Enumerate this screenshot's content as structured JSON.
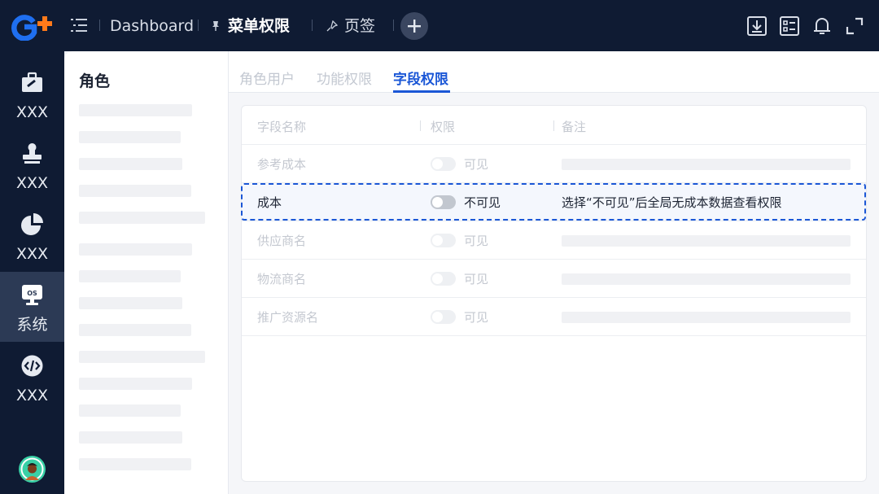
{
  "header": {
    "breadcrumbs": [
      {
        "label": "Dashboard"
      },
      {
        "label": "菜单权限",
        "active": true
      },
      {
        "label": "页签"
      }
    ],
    "tools": [
      "download-icon",
      "checklist-icon",
      "bell-icon",
      "fullscreen-icon"
    ]
  },
  "rail": {
    "items": [
      {
        "label": "XXX",
        "icon": "toolbox-icon"
      },
      {
        "label": "XXX",
        "icon": "stamp-icon"
      },
      {
        "label": "XXX",
        "icon": "pie-chart-icon"
      },
      {
        "label": "系统",
        "icon": "os-monitor-icon",
        "badge": "OS",
        "active": true
      },
      {
        "label": "XXX",
        "icon": "code-icon"
      }
    ]
  },
  "roles_panel": {
    "title": "角色"
  },
  "tabs": [
    {
      "label": "角色用户"
    },
    {
      "label": "功能权限"
    },
    {
      "label": "字段权限",
      "active": true
    }
  ],
  "table": {
    "columns": [
      "字段名称",
      "权限",
      "备注"
    ],
    "rows": [
      {
        "name": "参考成本",
        "permission": "可见",
        "enabled": true
      },
      {
        "name": "成本",
        "permission": "不可见",
        "enabled": false,
        "note": "选择“不可见”后全局无成本数据查看权限",
        "highlighted": true
      },
      {
        "name": "供应商名",
        "permission": "可见",
        "enabled": true
      },
      {
        "name": "物流商名",
        "permission": "可见",
        "enabled": true
      },
      {
        "name": "推广资源名",
        "permission": "可见",
        "enabled": true
      }
    ]
  },
  "colors": {
    "nav_bg": "#0f1b33",
    "accent": "#1b57d6",
    "logo_blue": "#1f6ff0",
    "logo_orange": "#ff7a1a"
  }
}
